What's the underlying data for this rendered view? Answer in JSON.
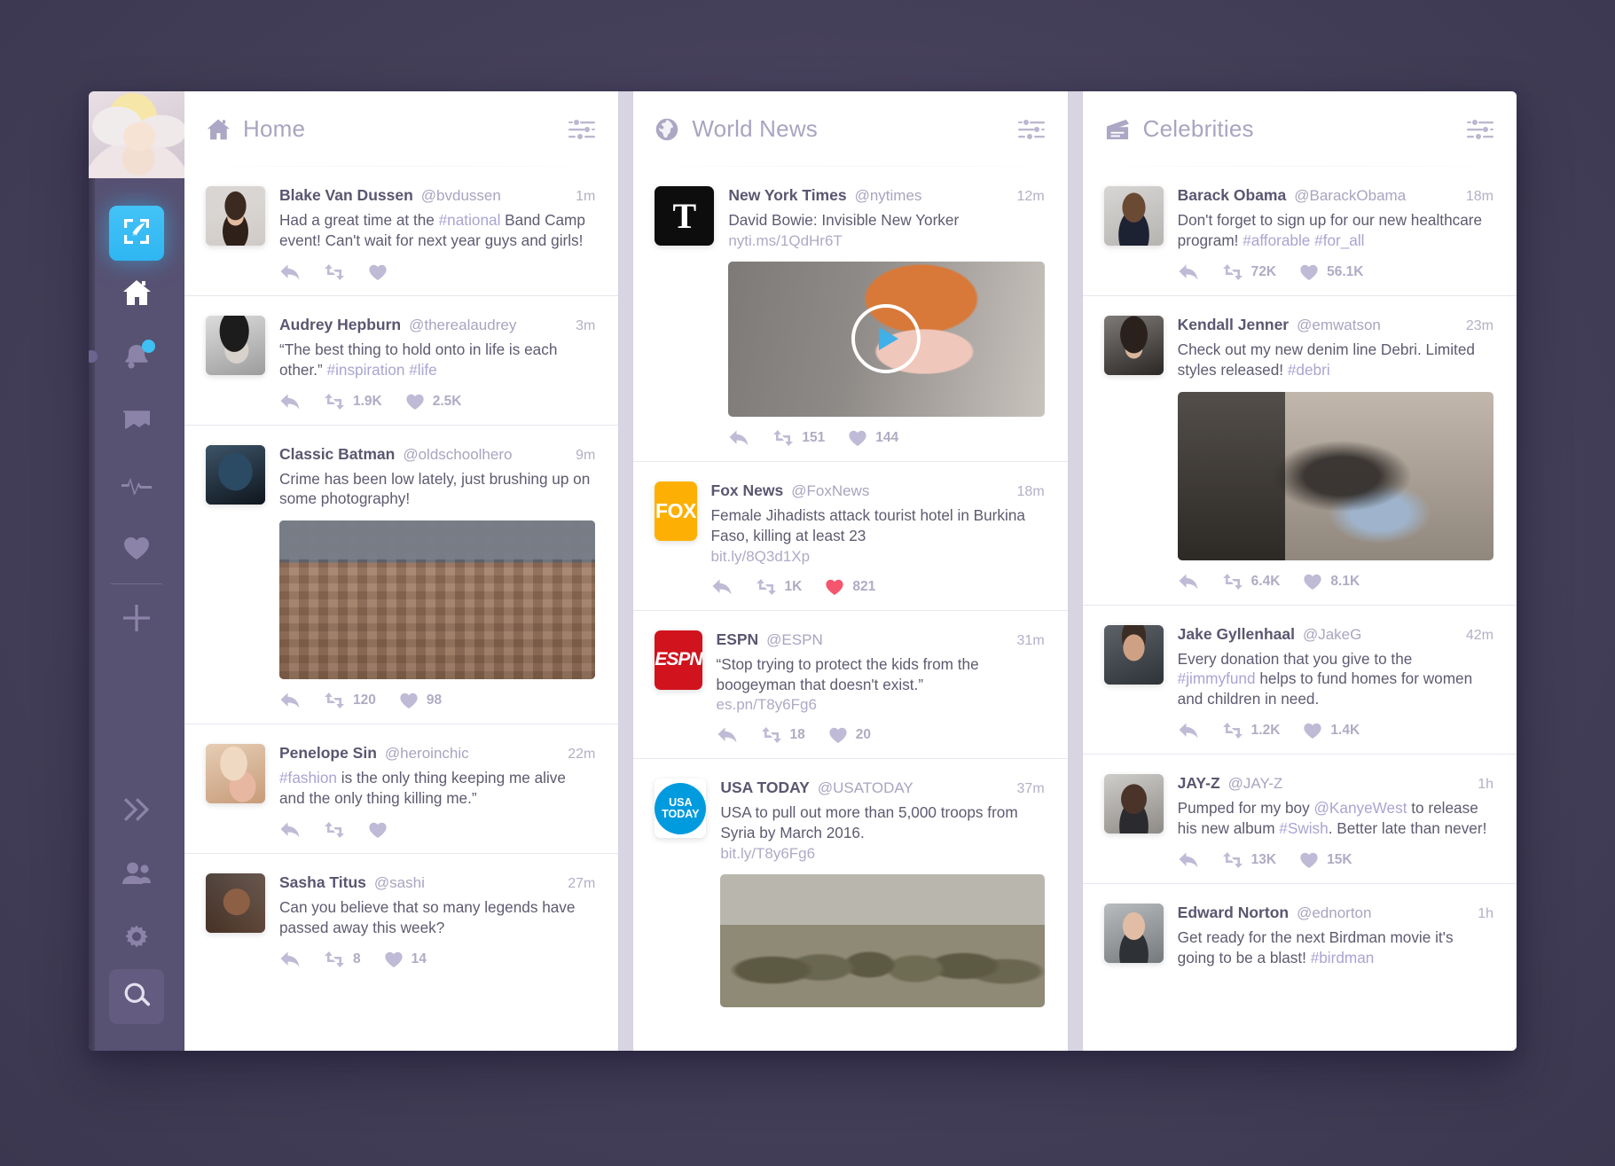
{
  "sidebar": {
    "avatar_name": "user-avatar",
    "compose_label": "compose",
    "items": [
      {
        "name": "home",
        "icon": "home-icon",
        "active": true
      },
      {
        "name": "notifications",
        "icon": "bell-icon",
        "badge": true
      },
      {
        "name": "messages",
        "icon": "envelope-icon"
      },
      {
        "name": "activity",
        "icon": "pulse-icon"
      },
      {
        "name": "likes",
        "icon": "heart-icon"
      },
      {
        "name": "add-column",
        "icon": "plus-icon"
      },
      {
        "name": "collapse",
        "icon": "double-chevron-right-icon"
      },
      {
        "name": "accounts",
        "icon": "people-icon"
      },
      {
        "name": "settings",
        "icon": "gear-icon"
      }
    ],
    "search_label": "search"
  },
  "columns": [
    {
      "id": "home",
      "title": "Home",
      "icon": "home-icon",
      "options_icon": "sliders-icon",
      "tweets": [
        {
          "name": "Blake Van Dussen",
          "handle": "@bvdussen",
          "time": "1m",
          "avatar": "p-blake",
          "text_parts": [
            {
              "t": "Had a great time at the ",
              "k": "plain"
            },
            {
              "t": "#national",
              "k": "tag"
            },
            {
              "t": " Band Camp event! Can't wait for next year guys and girls!",
              "k": "plain"
            }
          ],
          "actions": {
            "reply": "",
            "retweet": "",
            "like": "",
            "liked": false
          }
        },
        {
          "name": "Audrey Hepburn",
          "handle": "@therealaudrey",
          "time": "3m",
          "avatar": "p-audrey",
          "text_parts": [
            {
              "t": "“The best thing to hold onto in life is each other.” ",
              "k": "plain"
            },
            {
              "t": "#inspiration #life",
              "k": "tag"
            }
          ],
          "actions": {
            "reply": "",
            "retweet": "1.9K",
            "like": "2.5K",
            "liked": false
          }
        },
        {
          "name": "Classic Batman",
          "handle": "@oldschoolhero",
          "time": "9m",
          "avatar": "p-batman",
          "text_parts": [
            {
              "t": "Crime has been low lately, just brushing up on some photography!",
              "k": "plain"
            }
          ],
          "media": "m-rome",
          "actions": {
            "reply": "",
            "retweet": "120",
            "like": "98",
            "liked": false
          }
        },
        {
          "name": "Penelope Sin",
          "handle": "@heroinchic",
          "time": "22m",
          "avatar": "p-pen",
          "text_parts": [
            {
              "t": "#fashion",
              "k": "tag"
            },
            {
              "t": " is the only thing keeping me alive and the only thing killing me.”",
              "k": "plain"
            }
          ],
          "actions": {
            "reply": "",
            "retweet": "",
            "like": "",
            "liked": false
          }
        },
        {
          "name": "Sasha Titus",
          "handle": "@sashi",
          "time": "27m",
          "avatar": "p-sasha",
          "text_parts": [
            {
              "t": "Can you believe that so many legends have passed away this week?",
              "k": "plain"
            }
          ],
          "actions": {
            "reply": "",
            "retweet": "8",
            "like": "14",
            "liked": false
          }
        }
      ]
    },
    {
      "id": "world-news",
      "title": "World News",
      "icon": "globe-icon",
      "options_icon": "sliders-icon",
      "tweets": [
        {
          "name": "New York Times",
          "handle": "@nytimes",
          "time": "12m",
          "logo": "nyt",
          "logo_text": "T",
          "text_parts": [
            {
              "t": "David Bowie: Invisible New Yorker",
              "k": "plain"
            }
          ],
          "link": "nyti.ms/1QdHr6T",
          "media": "m-bowie",
          "media_play": true,
          "actions": {
            "reply": "",
            "retweet": "151",
            "like": "144",
            "liked": false
          }
        },
        {
          "name": "Fox News",
          "handle": "@FoxNews",
          "time": "18m",
          "logo": "fox",
          "logo_text": "FOX",
          "text_parts": [
            {
              "t": "Female Jihadists attack tourist hotel in Burkina Faso, killing at least 23",
              "k": "plain"
            }
          ],
          "link": "bit.ly/8Q3d1Xp",
          "actions": {
            "reply": "",
            "retweet": "1K",
            "like": "821",
            "liked": true
          }
        },
        {
          "name": "ESPN",
          "handle": "@ESPN",
          "time": "31m",
          "logo": "espn",
          "logo_text": "ESPN",
          "text_parts": [
            {
              "t": "“Stop trying to protect the kids from the boogeyman that doesn't exist.”",
              "k": "plain"
            }
          ],
          "link": "es.pn/T8y6Fg6",
          "actions": {
            "reply": "",
            "retweet": "18",
            "like": "20",
            "liked": false
          }
        },
        {
          "name": "USA TODAY",
          "handle": "@USATODAY",
          "time": "37m",
          "logo": "usa",
          "logo_text": "USA TODAY",
          "text_parts": [
            {
              "t": "USA to pull out more than 5,000 troops from Syria by March 2016.",
              "k": "plain"
            }
          ],
          "link": "bit.ly/T8y6Fg6",
          "media": "m-troops",
          "actions": {
            "reply": "",
            "retweet": "",
            "like": "",
            "liked": false
          }
        }
      ]
    },
    {
      "id": "celebrities",
      "title": "Celebrities",
      "icon": "clapperboard-icon",
      "options_icon": "sliders-icon",
      "tweets": [
        {
          "name": "Barack Obama",
          "handle": "@BarackObama",
          "time": "18m",
          "avatar": "p-obama",
          "text_parts": [
            {
              "t": "Don't forget to sign up for our new healthcare program! ",
              "k": "plain"
            },
            {
              "t": "#afforable #for_all",
              "k": "tag"
            }
          ],
          "actions": {
            "reply": "",
            "retweet": "72K",
            "like": "56.1K",
            "liked": false
          }
        },
        {
          "name": "Kendall Jenner",
          "handle": "@emwatson",
          "time": "23m",
          "avatar": "p-kendall",
          "text_parts": [
            {
              "t": "Check out my new denim line Debri. Limited styles released! ",
              "k": "plain"
            },
            {
              "t": "#debri",
              "k": "tag"
            }
          ],
          "media": "m-denim",
          "actions": {
            "reply": "",
            "retweet": "6.4K",
            "like": "8.1K",
            "liked": false
          }
        },
        {
          "name": "Jake Gyllenhaal",
          "handle": "@JakeG",
          "time": "42m",
          "avatar": "p-jake",
          "text_parts": [
            {
              "t": "Every donation that you give to the ",
              "k": "plain"
            },
            {
              "t": "#jimmyfund",
              "k": "tag"
            },
            {
              "t": " helps to fund homes for women and children in need.",
              "k": "plain"
            }
          ],
          "actions": {
            "reply": "",
            "retweet": "1.2K",
            "like": "1.4K",
            "liked": false
          }
        },
        {
          "name": "JAY-Z",
          "handle": "@JAY-Z",
          "time": "1h",
          "avatar": "p-jayz",
          "text_parts": [
            {
              "t": "Pumped for my boy ",
              "k": "plain"
            },
            {
              "t": "@KanyeWest",
              "k": "tag"
            },
            {
              "t": " to release his new album ",
              "k": "plain"
            },
            {
              "t": "#Swish",
              "k": "tag"
            },
            {
              "t": ". Better late than never!",
              "k": "plain"
            }
          ],
          "actions": {
            "reply": "",
            "retweet": "13K",
            "like": "15K",
            "liked": false
          }
        },
        {
          "name": "Edward Norton",
          "handle": "@ednorton",
          "time": "1h",
          "avatar": "p-edward",
          "text_parts": [
            {
              "t": "Get ready for the next Birdman movie it's going to be a blast! ",
              "k": "plain"
            },
            {
              "t": "#birdman",
              "k": "tag"
            }
          ],
          "actions": {
            "reply": "",
            "retweet": "",
            "like": "",
            "liked": false
          }
        }
      ]
    }
  ],
  "colors": {
    "accent": "#38bdf8",
    "sidebar": "#575172",
    "like_active": "#f5566e",
    "text": "#5f5a70",
    "muted": "#a9a4c0"
  }
}
